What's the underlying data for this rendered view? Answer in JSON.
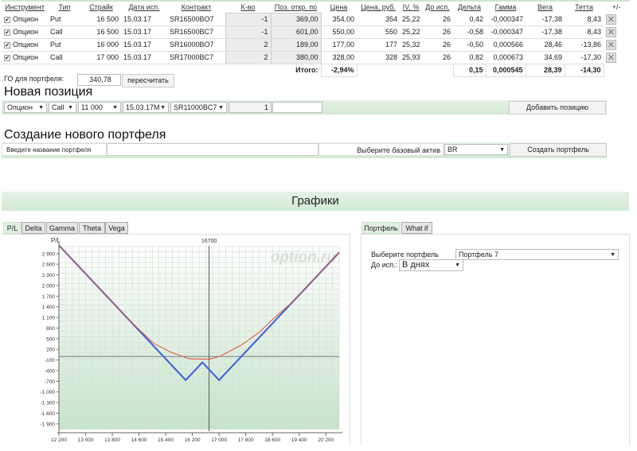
{
  "positions": {
    "headers": [
      "Инструмент",
      "Тип",
      "Страйк",
      "Дата исп.",
      "Контракт",
      "К-во",
      "Поз. откр. по",
      "Цена",
      "Цена, руб.",
      "IV, %",
      "До исп.",
      "Дельта",
      "Гамма",
      "Вега",
      "Тетта",
      "+/-"
    ],
    "rows": [
      {
        "instrument": "Опцион",
        "type": "Put",
        "strike": "16 500",
        "date": "15.03.17",
        "contract": "SR16500BO7",
        "qty": "-1",
        "open": "369,00",
        "price": "354,00",
        "price_rub": "354",
        "iv": "25,22",
        "days": "26",
        "delta": "0,42",
        "gamma": "-0,000347",
        "vega": "-17,38",
        "theta": "8,43"
      },
      {
        "instrument": "Опцион",
        "type": "Call",
        "strike": "16 500",
        "date": "15.03.17",
        "contract": "SR16500BC7",
        "qty": "-1",
        "open": "601,00",
        "price": "550,00",
        "price_rub": "550",
        "iv": "25,22",
        "days": "26",
        "delta": "-0,58",
        "gamma": "-0,000347",
        "vega": "-17,38",
        "theta": "8,43"
      },
      {
        "instrument": "Опцион",
        "type": "Put",
        "strike": "16 000",
        "date": "15.03.17",
        "contract": "SR16000BO7",
        "qty": "2",
        "open": "189,00",
        "price": "177,00",
        "price_rub": "177",
        "iv": "25,32",
        "days": "26",
        "delta": "-0,50",
        "gamma": "0,000566",
        "vega": "28,46",
        "theta": "-13,86"
      },
      {
        "instrument": "Опцион",
        "type": "Call",
        "strike": "17 000",
        "date": "15.03.17",
        "contract": "SR17000BC7",
        "qty": "2",
        "open": "380,00",
        "price": "328,00",
        "price_rub": "328",
        "iv": "25,93",
        "days": "26",
        "delta": "0,82",
        "gamma": "0,000673",
        "vega": "34,69",
        "theta": "-17,30"
      }
    ],
    "total": {
      "label": "Итого:",
      "change": "-2,94%",
      "delta": "0,15",
      "gamma": "0,000545",
      "vega": "28,39",
      "theta": "-14,30"
    },
    "checkmark": "✔",
    "delete_icon": "✕"
  },
  "go": {
    "label": "ГО для портфеля:",
    "value": "340,78",
    "recalc": "пересчитать"
  },
  "new_position": {
    "title": "Новая позиция",
    "instrument": "Опцион",
    "type": "Call",
    "strike": "11 000",
    "date": "15.03.17М",
    "contract": "SR11000BC7",
    "qty": "1",
    "add": "Добавить позицию"
  },
  "new_portfolio": {
    "title": "Создание нового портфеля",
    "name_label": "Введите название портфеля",
    "asset_label": "Выберите базовый актив",
    "asset": "BR",
    "create": "Создать портфель"
  },
  "charts": {
    "title": "Графики",
    "tabs": [
      "P/L",
      "Delta",
      "Gamma",
      "Theta",
      "Vega"
    ],
    "right_tabs": [
      "Портфель",
      "What if"
    ],
    "portfolio_label": "Выберите портфель",
    "portfolio": "Портфель 7",
    "exp_label": "До исп.:",
    "exp": "В днях",
    "watermark": "option.ru"
  },
  "chart_data": {
    "type": "line",
    "ylabel": "P/L",
    "xlim": [
      12200,
      20600
    ],
    "ylim": [
      -2060,
      3120
    ],
    "xticks": [
      "12 200",
      "13 000",
      "13 800",
      "14 600",
      "15 400",
      "16 200",
      "17 000",
      "17 800",
      "18 600",
      "19 400",
      "20 200"
    ],
    "xtick_values": [
      12200,
      13000,
      13800,
      14600,
      15400,
      16200,
      17000,
      17800,
      18600,
      19400,
      20200
    ],
    "yticks": [
      "2 900",
      "2 600",
      "2 300",
      "2 000",
      "1 700",
      "1 400",
      "1 100",
      "800",
      "500",
      "200",
      "-100",
      "-400",
      "-700",
      "-1 000",
      "-1 300",
      "-1 600",
      "-1 900"
    ],
    "ytick_values": [
      2900,
      2600,
      2300,
      2000,
      1700,
      1400,
      1100,
      800,
      500,
      200,
      -100,
      -400,
      -700,
      -1000,
      -1300,
      -1600,
      -1900
    ],
    "marker": {
      "x": 16700,
      "label": "16700"
    },
    "grid": true,
    "series": [
      {
        "color": "#3b5de0",
        "points": [
          [
            12200,
            3132
          ],
          [
            16000,
            -668
          ],
          [
            16500,
            -168
          ],
          [
            17000,
            -668
          ],
          [
            20600,
            2932
          ]
        ]
      },
      {
        "color": "#e0503a",
        "points": [
          [
            12200,
            3132
          ],
          [
            13800,
            1532
          ],
          [
            14400,
            940
          ],
          [
            15040,
            370
          ],
          [
            15560,
            120
          ],
          [
            16100,
            -65
          ],
          [
            16700,
            -80
          ],
          [
            17040,
            10
          ],
          [
            17700,
            340
          ],
          [
            18200,
            680
          ],
          [
            18600,
            1040
          ],
          [
            19200,
            1540
          ],
          [
            20600,
            2932
          ]
        ]
      }
    ]
  }
}
